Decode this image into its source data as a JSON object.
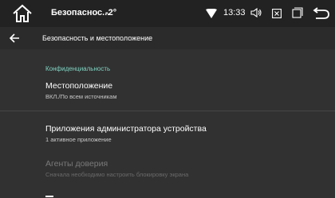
{
  "status_bar": {
    "title": "Безопаснос...",
    "temperature": "-2°",
    "time": "13:33"
  },
  "action_bar": {
    "title": "Безопасность и местоположение"
  },
  "section": {
    "header": "Конфиденциальность"
  },
  "preferences": [
    {
      "title": "Местоположение",
      "summary": "ВКЛ./По всем источникам",
      "enabled": true
    },
    {
      "title": "Приложения администратора устройства",
      "summary": "1 активное приложение",
      "enabled": true
    },
    {
      "title": "Агенты доверия",
      "summary": "Сначала необходимо настроить блокировку экрана",
      "enabled": false
    }
  ],
  "colors": {
    "accent": "#7fd4c2",
    "status_bar_bg": "#222222",
    "background": "#313131"
  }
}
